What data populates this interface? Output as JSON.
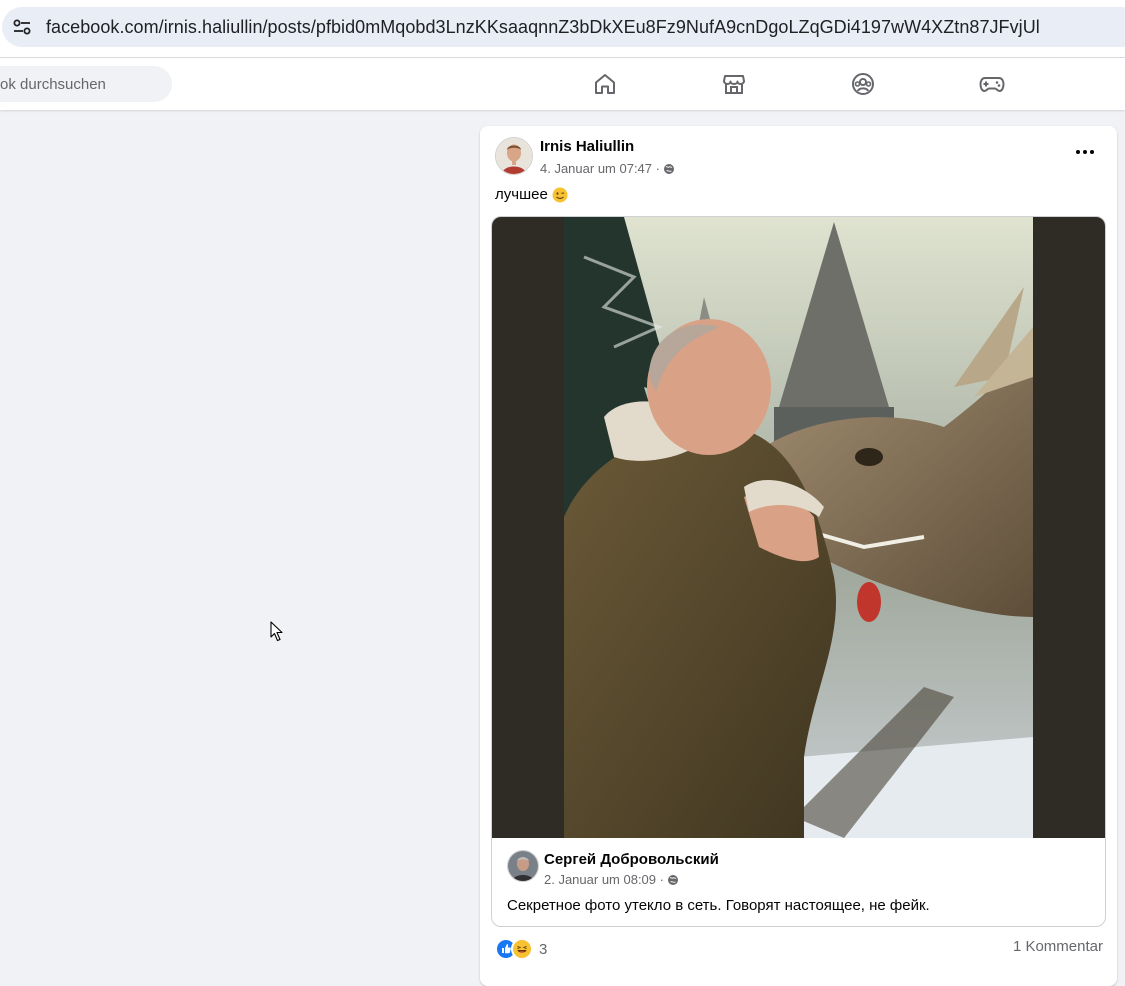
{
  "browser": {
    "url": "facebook.com/irnis.haliullin/posts/pfbid0mMqobd3LnzKKsaaqnnZ3bDkXEu8Fz9NufA9cnDgoLZqGDi4197wW4XZtn87JFvjUl",
    "site_info_icon": "tune-icon"
  },
  "nav": {
    "search_placeholder": "ok durchsuchen",
    "icons": [
      "home-icon",
      "marketplace-icon",
      "groups-icon",
      "gaming-icon"
    ]
  },
  "post": {
    "author": "Irnis Haliullin",
    "timestamp": "4. Januar um 07:47 ·",
    "text": "лучшее",
    "emoji": "smiley-icon",
    "shared": {
      "author": "Сергей Добровольский",
      "timestamp": "2. Januar um 08:09 ·",
      "text": "Секретное фото утекло в сеть. Говорят настоящее, не фейк."
    },
    "reaction_count": "3",
    "comments": "1 Kommentar"
  },
  "colors": {
    "fb_blue": "#1877f2",
    "background": "#f0f2f5",
    "secondary_text": "#65676b"
  }
}
